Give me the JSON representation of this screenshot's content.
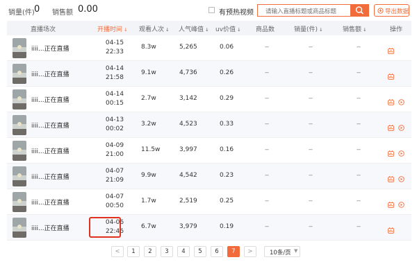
{
  "summary": {
    "sales_qty_label": "销量(件)",
    "sales_qty_value": "0",
    "sales_amt_label": "销售额",
    "sales_amt_value": "0.00"
  },
  "toolbar": {
    "preheat_label": "有预热视频",
    "search_placeholder": "请输入直播标题或商品标题",
    "export_label": "导出数据"
  },
  "columns": [
    {
      "label": "直播场次",
      "sort": ""
    },
    {
      "label": "开播时间",
      "sort": "↓",
      "active": true
    },
    {
      "label": "观看人次",
      "sort": "↓"
    },
    {
      "label": "人气峰值",
      "sort": "↓"
    },
    {
      "label": "uv价值",
      "sort": "↓"
    },
    {
      "label": "商品数",
      "sort": ""
    },
    {
      "label": "销量(件)",
      "sort": "↓"
    },
    {
      "label": "销售额",
      "sort": "↓"
    },
    {
      "label": "操作",
      "sort": ""
    }
  ],
  "rows": [
    {
      "name": "iiii...正在直播",
      "date": "04-15",
      "time": "22:33",
      "views": "8.3w",
      "peak": "5,265",
      "uv": "0.06",
      "goods": "--",
      "qty": "--",
      "amount": "--",
      "has_play": false
    },
    {
      "name": "iiii...正在直播",
      "date": "04-14",
      "time": "21:58",
      "views": "9.1w",
      "peak": "4,736",
      "uv": "0.26",
      "goods": "--",
      "qty": "--",
      "amount": "--",
      "has_play": false
    },
    {
      "name": "iiii...正在直播",
      "date": "04-14",
      "time": "00:15",
      "views": "2.7w",
      "peak": "3,142",
      "uv": "0.29",
      "goods": "--",
      "qty": "--",
      "amount": "--",
      "has_play": true
    },
    {
      "name": "iiii...正在直播",
      "date": "04-13",
      "time": "00:02",
      "views": "3.2w",
      "peak": "4,523",
      "uv": "0.33",
      "goods": "--",
      "qty": "--",
      "amount": "--",
      "has_play": true
    },
    {
      "name": "iiii...正在直播",
      "date": "04-09",
      "time": "21:00",
      "views": "11.5w",
      "peak": "3,997",
      "uv": "0.16",
      "goods": "--",
      "qty": "--",
      "amount": "--",
      "has_play": true
    },
    {
      "name": "iiii...正在直播",
      "date": "04-07",
      "time": "21:09",
      "views": "9.9w",
      "peak": "4,542",
      "uv": "0.23",
      "goods": "--",
      "qty": "--",
      "amount": "--",
      "has_play": true
    },
    {
      "name": "iiii...正在直播",
      "date": "04-07",
      "time": "00:50",
      "views": "1.7w",
      "peak": "2,519",
      "uv": "0.25",
      "goods": "--",
      "qty": "--",
      "amount": "--",
      "has_play": true
    },
    {
      "name": "iiii...正在直播",
      "date": "04-06",
      "time": "22:46",
      "views": "6.7w",
      "peak": "3,979",
      "uv": "0.19",
      "goods": "--",
      "qty": "--",
      "amount": "--",
      "has_play": false
    }
  ],
  "pagination": {
    "prev": "<",
    "next": ">",
    "pages": [
      "1",
      "2",
      "3",
      "4",
      "5",
      "6",
      "7"
    ],
    "current": "7",
    "page_size": "10条/页"
  },
  "colors": {
    "accent": "#f26b3a",
    "highlight": "#e0301e"
  },
  "icons": {
    "search": "search-icon",
    "export": "export-icon",
    "chart": "chart-icon",
    "play": "play-icon",
    "dropdown": "chevron-down-icon"
  }
}
